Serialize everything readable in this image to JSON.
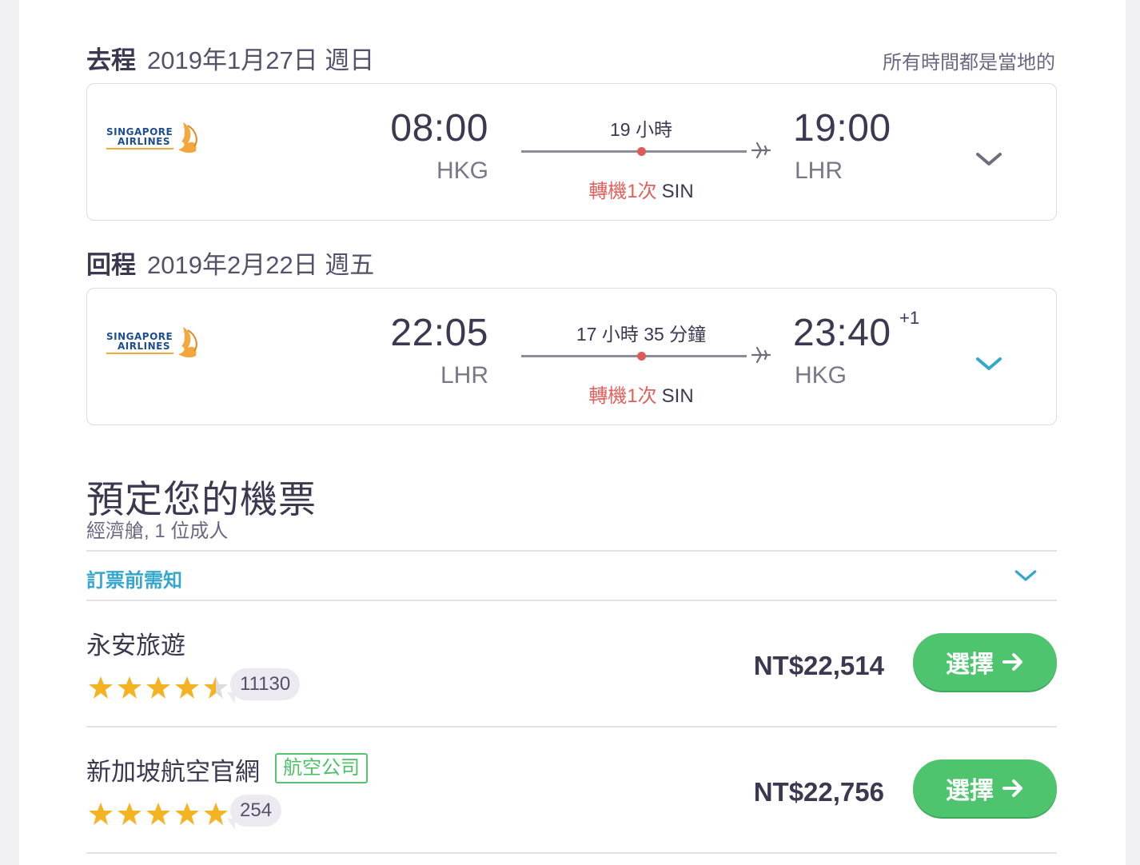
{
  "outbound": {
    "label": "去程",
    "date": "2019年1月27日 週日",
    "local_note": "所有時間都是當地的",
    "airline_logo": "SINGAPORE AIRLINES",
    "depart_time": "08:00",
    "depart_code": "HKG",
    "duration": "19 小時",
    "stops_label": "轉機1次",
    "stop_airport": "SIN",
    "arrive_time": "19:00",
    "arrive_code": "LHR",
    "expand_icon": "chevron-down-icon"
  },
  "inbound": {
    "label": "回程",
    "date": "2019年2月22日 週五",
    "airline_logo": "SINGAPORE AIRLINES",
    "depart_time": "22:05",
    "depart_code": "LHR",
    "duration": "17 小時 35 分鐘",
    "stops_label": "轉機1次",
    "stop_airport": "SIN",
    "arrive_time": "23:40",
    "arrive_day_offset": "+1",
    "arrive_code": "HKG",
    "expand_icon": "chevron-down-icon"
  },
  "booking": {
    "title": "預定您的機票",
    "subtitle": "經濟艙, 1 位成人",
    "notice_label": "訂票前需知"
  },
  "offers": [
    {
      "agent": "永安旅遊",
      "rating": 4.5,
      "reviews": "11130",
      "price": "NT$22,514",
      "button": "選擇"
    },
    {
      "agent": "新加坡航空官網",
      "badge": "航空公司",
      "rating": 5,
      "reviews": "254",
      "price": "NT$22,756",
      "button": "選擇"
    }
  ],
  "colors": {
    "accent_blue": "#35a6cc",
    "stop_red": "#e0605c",
    "select_green": "#4fc46e",
    "star_gold": "#f5b323"
  }
}
